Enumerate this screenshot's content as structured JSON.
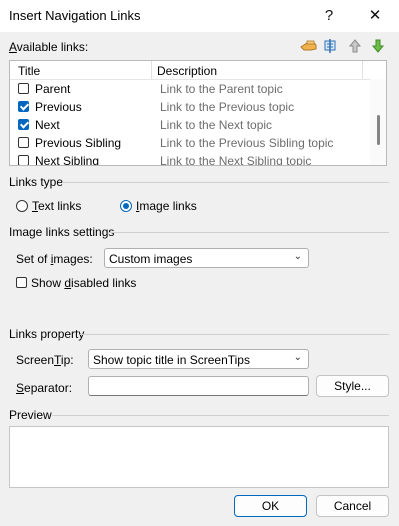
{
  "window": {
    "title": "Insert Navigation Links",
    "help_glyph": "?",
    "close_glyph": "✕"
  },
  "available_links": {
    "label_pre": "",
    "label_u": "A",
    "label_post": "vailable links:",
    "toolbar_icons": [
      "hand-pointer-icon",
      "align-icon",
      "arrow-up-icon",
      "arrow-down-icon"
    ],
    "columns": [
      "Title",
      "Description"
    ],
    "rows": [
      {
        "title": "Parent",
        "description": "Link to the Parent topic",
        "checked": false
      },
      {
        "title": "Previous",
        "description": "Link to the Previous topic",
        "checked": true
      },
      {
        "title": "Next",
        "description": "Link to the Next topic",
        "checked": true
      },
      {
        "title": "Previous Sibling",
        "description": "Link to the Previous Sibling topic",
        "checked": false
      },
      {
        "title": "Next Sibling",
        "description": "Link to the Next Sibling topic",
        "checked": false
      }
    ]
  },
  "links_type": {
    "heading": "Links type",
    "text_links_u": "T",
    "text_links_post": "ext links",
    "image_links_u": "I",
    "image_links_post": "mage links",
    "selected": "image"
  },
  "image_links_settings": {
    "heading": "Image links settings",
    "set_of_images_pre": "Set of ",
    "set_of_images_u": "i",
    "set_of_images_post": "mages:",
    "set_of_images_value": "Custom images",
    "show_disabled_pre": "Show ",
    "show_disabled_u": "d",
    "show_disabled_post": "isabled links",
    "show_disabled_checked": false
  },
  "links_property": {
    "heading": "Links property",
    "screentip_pre": "Screen",
    "screentip_u": "T",
    "screentip_post": "ip:",
    "screentip_value": "Show topic title in ScreenTips",
    "separator_pre": "",
    "separator_u": "S",
    "separator_post": "eparator:",
    "separator_value": "",
    "style_button": "Style..."
  },
  "preview": {
    "heading": "Preview"
  },
  "footer": {
    "ok": "OK",
    "cancel": "Cancel"
  },
  "colors": {
    "accent": "#0067c0",
    "window_bg": "#f0f0f0"
  }
}
